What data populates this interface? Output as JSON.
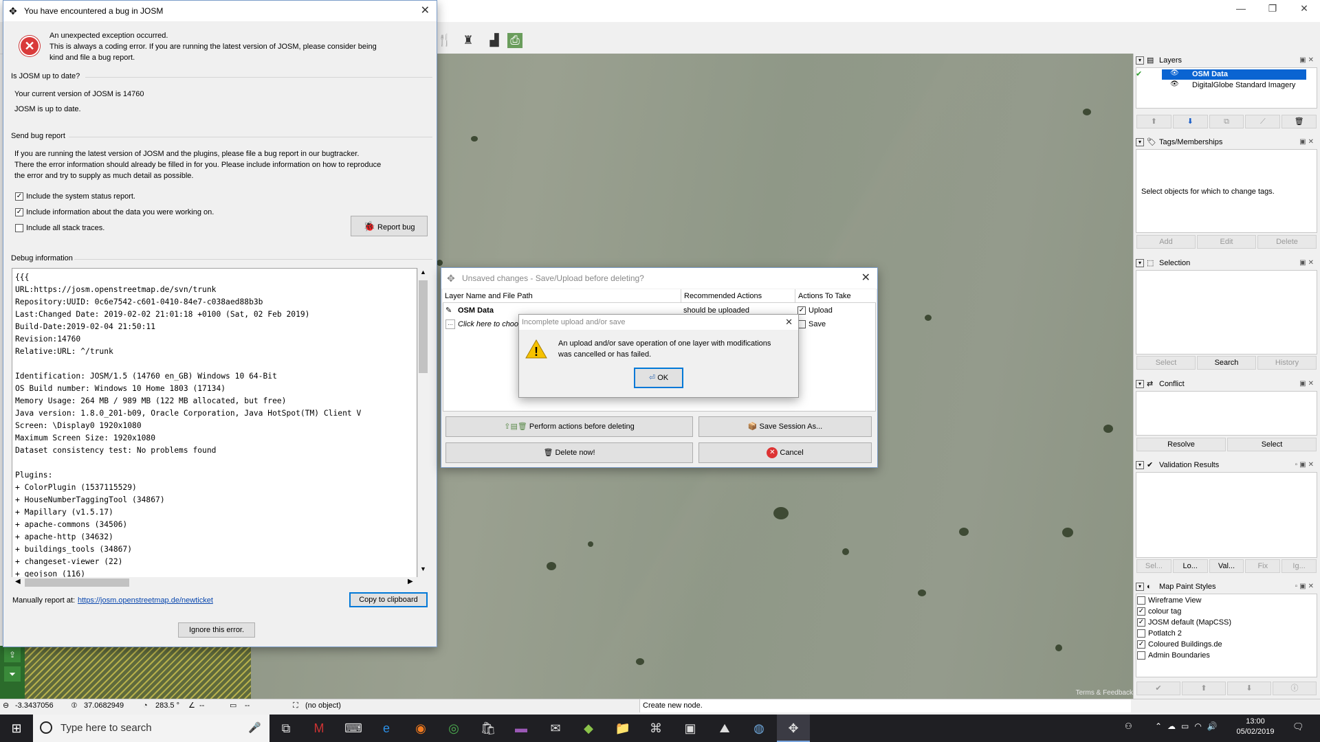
{
  "main_window": {
    "controls": [
      "—",
      "❐",
      "✕"
    ]
  },
  "map": {
    "terms": "Terms & Feedback"
  },
  "bug_dialog": {
    "title": "You have encountered a bug in JOSM",
    "intro_1": "An unexpected exception occurred.",
    "intro_2": "This is always a coding error. If you are running the latest version of JOSM, please consider being",
    "intro_3": "kind and file a bug report.",
    "section_uptodate": "Is JOSM up to date?",
    "current_version": "Your current version of JOSM is 14760",
    "up_to_date": "JOSM is up to date.",
    "section_send": "Send bug report",
    "send_text_1": "If you are running the latest version of JOSM and the plugins, please file a bug report in our bugtracker.",
    "send_text_2": "There the error information should already be filled in for you. Please include information on how to reproduce",
    "send_text_3": "the error and try to supply as much detail as possible.",
    "checkboxes": [
      {
        "label": "Include the system status report.",
        "checked": "✓"
      },
      {
        "label": "Include information about the data you were working on.",
        "checked": "✓"
      },
      {
        "label": "Include all stack traces.",
        "checked": ""
      }
    ],
    "report_bug": "Report bug",
    "section_debug": "Debug information",
    "debug_text": "{{{\nURL:https://josm.openstreetmap.de/svn/trunk\nRepository:UUID: 0c6e7542-c601-0410-84e7-c038aed88b3b\nLast:Changed Date: 2019-02-02 21:01:18 +0100 (Sat, 02 Feb 2019)\nBuild-Date:2019-02-04 21:50:11\nRevision:14760\nRelative:URL: ^/trunk\n\nIdentification: JOSM/1.5 (14760 en_GB) Windows 10 64-Bit\nOS Build number: Windows 10 Home 1803 (17134)\nMemory Usage: 264 MB / 989 MB (122 MB allocated, but free)\nJava version: 1.8.0_201-b09, Oracle Corporation, Java HotSpot(TM) Client V\nScreen: \\Display0 1920x1080\nMaximum Screen Size: 1920x1080\nDataset consistency test: No problems found\n\nPlugins:\n+ ColorPlugin (1537115529)\n+ HouseNumberTaggingTool (34867)\n+ Mapillary (v1.5.17)\n+ apache-commons (34506)\n+ apache-http (34632)\n+ buildings_tools (34867)\n+ changeset-viewer (22)\n+ geojson (116)",
    "manual_label": "Manually report at:",
    "manual_link": "https://josm.openstreetmap.de/newticket",
    "copy_clipboard": "Copy to clipboard",
    "ignore": "Ignore this error."
  },
  "unsaved_dialog": {
    "title": "Unsaved changes - Save/Upload before deleting?",
    "columns": [
      "Layer Name and File Path",
      "Recommended Actions",
      "Actions To Take"
    ],
    "row1_name": "OSM Data",
    "row1_action": "should be uploaded",
    "row1_take": "Upload",
    "row2_name": "Click here to choose",
    "row2_take": "Save",
    "perform": "Perform actions before deleting",
    "save_session": "Save Session As...",
    "delete_now": "Delete now!",
    "cancel": "Cancel"
  },
  "incomplete_dialog": {
    "title": "Incomplete upload and/or save",
    "message_1": "An upload and/or save operation of one layer with modifications",
    "message_2": "was cancelled or has failed.",
    "ok": "OK"
  },
  "panels": {
    "layers": {
      "title": "Layers",
      "items": [
        "OSM Data",
        "DigitalGlobe Standard Imagery"
      ]
    },
    "tags": {
      "title": "Tags/Memberships",
      "empty": "Select objects for which to change tags.",
      "buttons": [
        "Add",
        "Edit",
        "Delete"
      ]
    },
    "selection": {
      "title": "Selection",
      "buttons": [
        "Select",
        "Search",
        "History"
      ]
    },
    "conflict": {
      "title": "Conflict",
      "buttons": [
        "Resolve",
        "Select"
      ]
    },
    "validation": {
      "title": "Validation Results",
      "buttons": [
        "Sel...",
        "Lo...",
        "Val...",
        "Fix",
        "Ig..."
      ]
    },
    "mappaint": {
      "title": "Map Paint Styles",
      "items": [
        {
          "label": "Wireframe View",
          "checked": ""
        },
        {
          "label": "colour tag",
          "checked": "✓"
        },
        {
          "label": "JOSM default (MapCSS)",
          "checked": "✓"
        },
        {
          "label": "Potlatch 2",
          "checked": ""
        },
        {
          "label": "Coloured Buildings.de",
          "checked": "✓"
        },
        {
          "label": "Admin Boundaries",
          "checked": ""
        }
      ]
    }
  },
  "statusbar": {
    "lon": "-3.3437056",
    "lat": "37.0682949",
    "heading": "283.5 °",
    "angle": "--",
    "dist": "--",
    "object": "(no object)",
    "message": "Create new node."
  },
  "taskbar": {
    "search_placeholder": "Type here to search",
    "time": "13:00",
    "date": "05/02/2019"
  }
}
